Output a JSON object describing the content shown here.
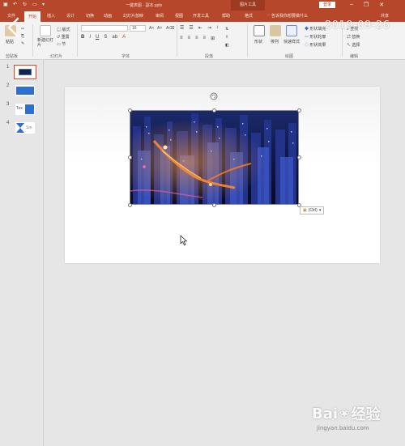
{
  "window": {
    "title": "一键表图 · 副本.pptx",
    "context_tool": "图片工具",
    "login_label": "登录",
    "controls": [
      "–",
      "❐",
      "✕"
    ]
  },
  "tabs": [
    "文件",
    "开始",
    "插入",
    "设计",
    "切换",
    "动画",
    "幻灯片放映",
    "审阅",
    "视图",
    "开发工具",
    "帮助",
    "格式"
  ],
  "active_tab": "开始",
  "tellme": "告诉我你想要做什么",
  "share": "共享",
  "ribbon": {
    "clipboard": {
      "paste": "粘贴",
      "label": "剪贴板"
    },
    "slides": {
      "new_slide": "新建幻灯片",
      "layout": "版式",
      "reset": "重置",
      "section": "节",
      "label": "幻灯片"
    },
    "font": {
      "size": "16",
      "label": "字体",
      "format_buttons": [
        "B",
        "I",
        "U",
        "S",
        "ab",
        "A"
      ]
    },
    "paragraph": {
      "label": "段落",
      "row1": [
        "☰",
        "☰",
        "⇤",
        "⇥",
        "↕"
      ],
      "row2": [
        "≡",
        "≡",
        "≡",
        "≡",
        "⊞"
      ]
    },
    "drawing": {
      "shapes": "形状",
      "arrange": "排列",
      "quick_styles": "快速样式",
      "fill": "形状填充",
      "outline": "形状轮廓",
      "effects": "形状效果",
      "label": "绘图"
    },
    "editing": {
      "find": "查找",
      "replace": "替换",
      "select": "选择",
      "label": "编辑"
    }
  },
  "timestamp": "2019-09-26",
  "slides": [
    {
      "num": "1",
      "selected": true
    },
    {
      "num": "2",
      "selected": false
    },
    {
      "num": "3",
      "selected": false
    },
    {
      "num": "4",
      "selected": false
    }
  ],
  "thumb_texts": {
    "t3": "Tex",
    "t4": "Sm"
  },
  "paste_options": "(Ctrl)",
  "watermark": {
    "brand_a": "Bai",
    "brand_b": "经验",
    "url": "jingyan.baidu.com"
  },
  "colors": {
    "accent": "#b7472a",
    "ribbon_bg": "#f3f3f3",
    "workspace": "#e6e6e6"
  }
}
